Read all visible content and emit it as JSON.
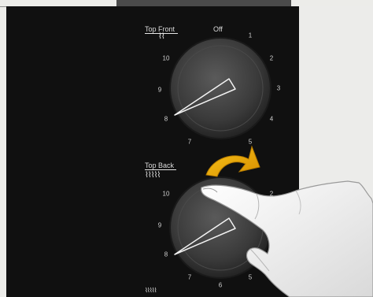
{
  "knobs": {
    "top_front": {
      "label": "Top Front",
      "off_label": "Off",
      "dial_numbers": [
        "1",
        "2",
        "3",
        "4",
        "5",
        "7",
        "8",
        "9",
        "10"
      ],
      "icon": "burner-coil-icon"
    },
    "top_back": {
      "label": "Top Back",
      "dial_numbers": [
        "10",
        "9",
        "8",
        "7",
        "6",
        "5",
        "2"
      ],
      "icon": "burner-coil-icon"
    }
  },
  "illustration": {
    "rotation_arrow": "rotate-arrow-icon",
    "hand": "pointing-hand",
    "colors": {
      "panel": "#101010",
      "arrow": "#e8a400",
      "knob": "#3c3c3c",
      "background": "#ececea"
    }
  }
}
